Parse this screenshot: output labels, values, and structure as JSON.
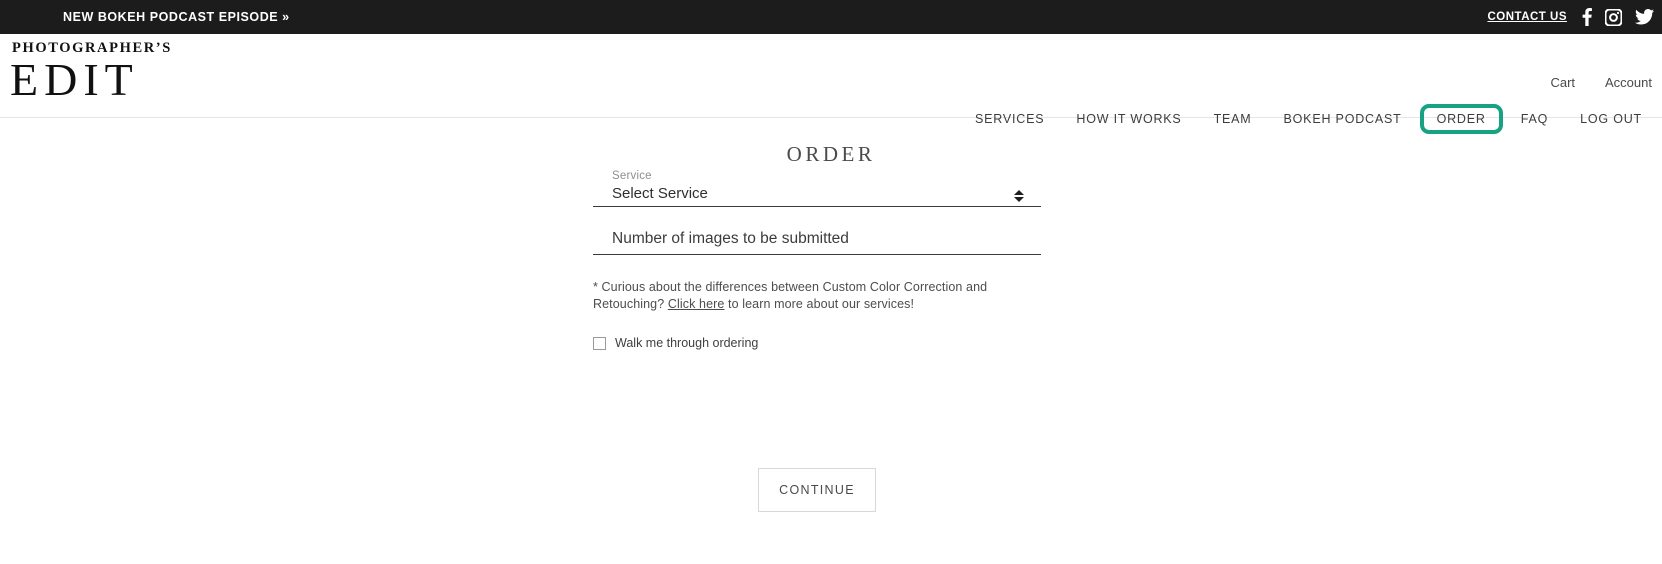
{
  "topbar": {
    "promo": "NEW BOKEH PODCAST EPISODE »",
    "contact": "CONTACT US",
    "social": [
      {
        "name": "facebook-icon"
      },
      {
        "name": "instagram-icon"
      },
      {
        "name": "twitter-icon"
      }
    ]
  },
  "header": {
    "logo_top": "PHOTOGRAPHER’S",
    "logo_main": "EDIT",
    "util": [
      {
        "label": "Cart",
        "name": "cart-link"
      },
      {
        "label": "Account",
        "name": "account-link"
      }
    ],
    "nav": [
      {
        "label": "SERVICES",
        "name": "nav-services",
        "highlighted": false
      },
      {
        "label": "HOW IT WORKS",
        "name": "nav-how-it-works",
        "highlighted": false
      },
      {
        "label": "TEAM",
        "name": "nav-team",
        "highlighted": false
      },
      {
        "label": "BOKEH PODCAST",
        "name": "nav-bokeh-podcast",
        "highlighted": false
      },
      {
        "label": "ORDER",
        "name": "nav-order",
        "highlighted": true
      },
      {
        "label": "FAQ",
        "name": "nav-faq",
        "highlighted": false
      },
      {
        "label": "LOG OUT",
        "name": "nav-log-out",
        "highlighted": false
      }
    ],
    "highlight_color": "#17a383"
  },
  "main": {
    "title": "ORDER",
    "service_field": {
      "label": "Service",
      "value": "Select Service"
    },
    "images_field": {
      "placeholder": "Number of images to be submitted",
      "value": ""
    },
    "info": {
      "part1": "* Curious about the differences between Custom Color Correction and Retouching? ",
      "link": "Click here",
      "part2": " to learn more about our services!"
    },
    "checkbox": {
      "label": "Walk me through ordering",
      "checked": false
    },
    "continue_label": "CONTINUE"
  }
}
